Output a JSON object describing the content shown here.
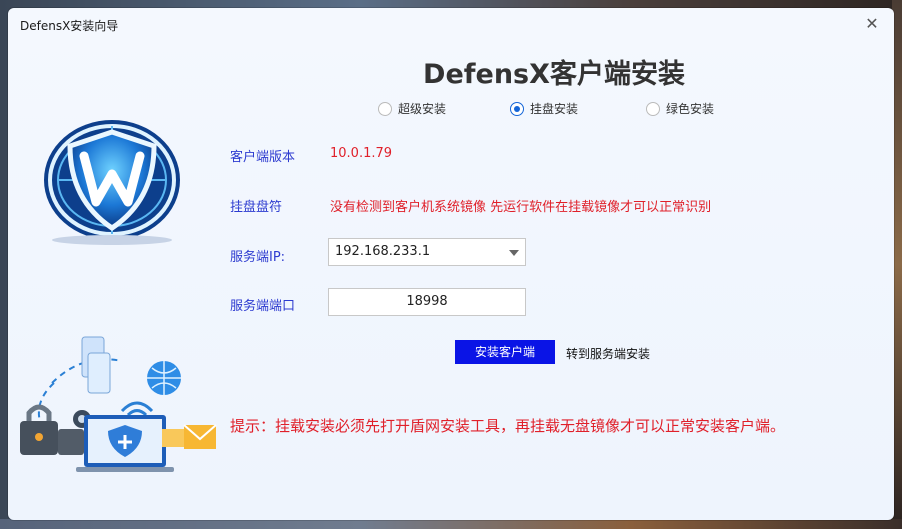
{
  "window": {
    "title": "DefensX安装向导",
    "close_icon": "close-icon"
  },
  "heading": "DefensX客户端安装",
  "install_modes": [
    {
      "label": "超级安装",
      "checked": false
    },
    {
      "label": "挂盘安装",
      "checked": true
    },
    {
      "label": "绿色安装",
      "checked": false
    }
  ],
  "fields": {
    "version_label": "客户端版本",
    "version_value": "10.0.1.79",
    "drive_label": "挂盘盘符",
    "drive_value": "没有检测到客户机系统镜像 先运行软件在挂载镜像才可以正常识别",
    "ip_label": "服务端IP:",
    "ip_value": "192.168.233.1",
    "port_label": "服务端端口",
    "port_value": "18998"
  },
  "actions": {
    "install_label": "安装客户端",
    "switch_label": "转到服务端安装"
  },
  "hint": "提示：挂载安装必须先打开盾网安装工具，再挂载无盘镜像才可以正常安装客户端。",
  "colors": {
    "accent": "#0a14e6",
    "label": "#2d3bd0",
    "warning": "#e0202a"
  }
}
